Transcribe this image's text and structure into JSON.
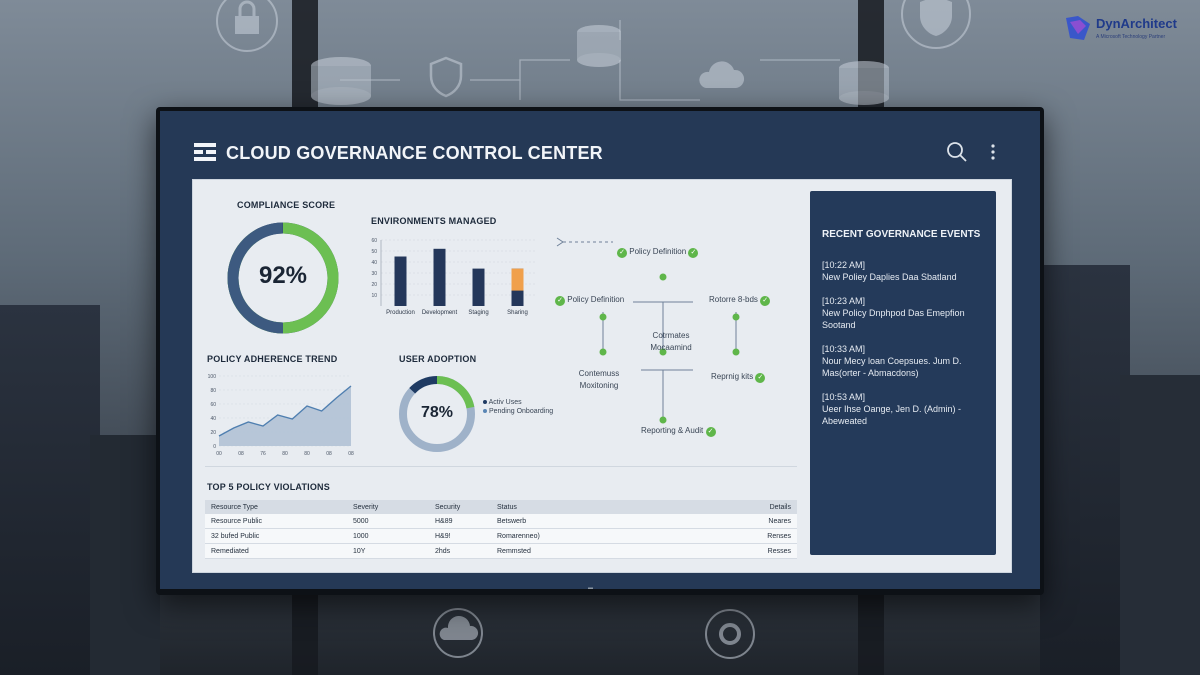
{
  "brand": {
    "name": "DynArchitect",
    "tagline": "A Microsoft Technology Partner"
  },
  "app": {
    "title": "CLOUD GOVERNANCE CONTROL CENTER"
  },
  "compliance": {
    "title": "COMPLIANCE SCORE",
    "value_label": "92%",
    "value": 0.92
  },
  "environments": {
    "title": "ENVIRONMENTS MANAGED",
    "chart_data": {
      "type": "bar",
      "categories": [
        "Production",
        "Development",
        "Staging",
        "Sharing"
      ],
      "values": [
        45,
        52,
        34,
        34
      ],
      "highlight_overlay": [
        0,
        0,
        0,
        20
      ],
      "ylim": [
        0,
        60
      ],
      "y_ticks": [
        "10",
        "20",
        "30",
        "40",
        "50",
        "60"
      ]
    }
  },
  "workflow": {
    "nodes": {
      "policy_definition_top": "Policy Definition",
      "policy_definition_left": "Policy Definition",
      "center": "Cotrmates Mocaamind",
      "restore": "Rotorre 8-bds",
      "monitoring": "Contemuss Moxitoning",
      "reporting_kits": "Reprnig kits",
      "reporting_audit": "Reporting & Audit"
    }
  },
  "trend": {
    "title": "POLICY ADHERENCE TREND",
    "chart_data": {
      "type": "area",
      "values": [
        10,
        18,
        24,
        20,
        31,
        27,
        40,
        35,
        48,
        60
      ],
      "ylim": [
        0,
        70
      ],
      "y_ticks": [
        "100",
        "80",
        "60",
        "40",
        "20",
        "0"
      ],
      "x_ticks": [
        "00",
        "08",
        "76",
        "80",
        "80",
        "08",
        "08"
      ]
    }
  },
  "adoption": {
    "title": "USER ADOPTION",
    "value_label": "78%",
    "value": 0.78,
    "legend": [
      "Activ Uses",
      "Pending Onboarding"
    ],
    "colors": {
      "active": "#1f3b63",
      "pending": "#6cbf52",
      "rest": "#9fb2c9"
    }
  },
  "violations": {
    "title": "TOP 5 POLICY VIOLATIONS",
    "columns": [
      "Resource Type",
      "Severity",
      "Security",
      "Status",
      "Details"
    ],
    "rows": [
      [
        "Resource Public",
        "5000",
        "H&89",
        "Betswerb",
        "Neares"
      ],
      [
        "32 bufed Public",
        "1000",
        "H&9!",
        "Romarenneo)",
        "Renses"
      ],
      [
        "Remediated",
        "10Y",
        "2hds",
        "Remmsted",
        "Resses"
      ]
    ]
  },
  "events": {
    "title": "RECENT GOVERNANCE EVENTS",
    "items": [
      {
        "time": "[10:22 AM]",
        "text": "New Poliey Daplies Daa Sbatland"
      },
      {
        "time": "[10:23 AM]",
        "text": "New Policy Dnphpod Das Emepfion Sootand"
      },
      {
        "time": "[10:33 AM]",
        "text": "Nour Mecy loan Coepsues. Jum D. Mas(orter - Abmacdons)"
      },
      {
        "time": "[10:53 AM]",
        "text": "Ueer Ihse Oange, Jen D. (Admin) - Abeweated"
      }
    ]
  },
  "colors": {
    "navy": "#243a5a",
    "green": "#6cbf52",
    "orange": "#f0a04b",
    "bar": "#24375a"
  }
}
